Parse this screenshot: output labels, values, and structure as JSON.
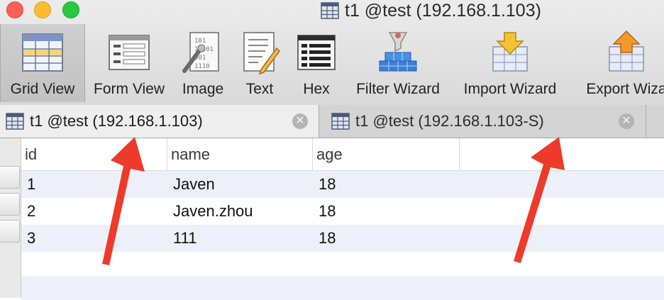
{
  "window": {
    "title": "t1 @test (192.168.1.103)"
  },
  "toolbar": {
    "items": [
      {
        "label": "Grid View",
        "icon": "grid-view-icon",
        "active": true
      },
      {
        "label": "Form View",
        "icon": "form-view-icon"
      },
      {
        "label": "Image",
        "icon": "image-icon"
      },
      {
        "label": "Text",
        "icon": "text-icon"
      },
      {
        "label": "Hex",
        "icon": "hex-icon"
      },
      {
        "label": "Filter Wizard",
        "icon": "filter-wizard-icon"
      },
      {
        "label": "Import Wizard",
        "icon": "import-wizard-icon"
      },
      {
        "label": "Export Wiza",
        "icon": "export-wizard-icon"
      }
    ]
  },
  "tabs": [
    {
      "label": "t1 @test (192.168.1.103)",
      "active": true,
      "close_glyph": "✕"
    },
    {
      "label": "t1 @test (192.168.1.103-S)",
      "active": false,
      "close_glyph": "✕"
    }
  ],
  "table": {
    "columns": [
      "id",
      "name",
      "age"
    ],
    "rows": [
      [
        "1",
        "Javen",
        "18"
      ],
      [
        "2",
        "Javen.zhou",
        "18"
      ],
      [
        "3",
        "111",
        "18"
      ]
    ]
  },
  "colors": {
    "alt_row": "#edf0f8",
    "arrow": "#ee3a2b",
    "close_red": "#fc5f57",
    "minimize_yellow": "#fdbc2e",
    "zoom_green": "#29c840"
  }
}
